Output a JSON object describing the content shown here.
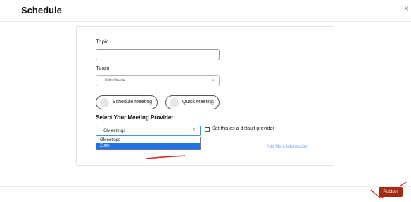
{
  "header": {
    "title": "Schedule",
    "close_glyph": "×"
  },
  "form": {
    "topic_label": "Topic",
    "topic_value": "",
    "team_label": "Team",
    "team_selected": "10th Grade",
    "meeting_types": [
      {
        "label": "Schedule Meeting"
      },
      {
        "label": "Quick Meeting"
      }
    ],
    "provider_section_title": "Select Your Meeting Provider",
    "provider_selected": "GMeetings",
    "provider_options": [
      {
        "label": "GMeetings",
        "highlighted": false
      },
      {
        "label": "Zoom",
        "highlighted": true
      }
    ],
    "default_provider_label": "Set this as a default provider",
    "default_provider_checked": false,
    "add_more_link": "Add More Information"
  },
  "footer": {
    "publish_label": "Publish"
  },
  "colors": {
    "publish_bg": "#a02a12",
    "highlight": "#1e73e8",
    "annotation": "#d8201b"
  },
  "icons": {
    "close": "close-icon",
    "select_arrows": "sort-arrows-icon",
    "radio": "radio-dot-icon"
  }
}
